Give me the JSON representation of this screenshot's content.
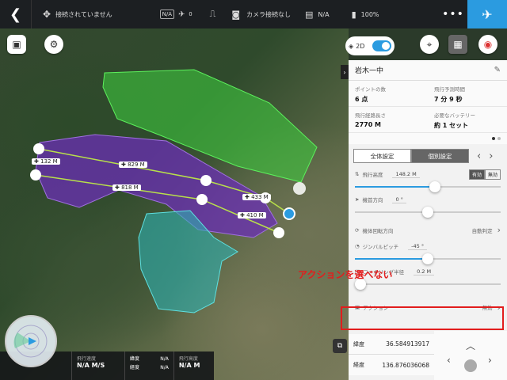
{
  "topbar": {
    "status": "接続されていません",
    "gps_badge": "N/A",
    "sat_count": "0",
    "camera": "カメラ接続なし",
    "storage": "N/A",
    "battery": "100%"
  },
  "map": {
    "toggle_label": "2D",
    "distances": [
      "132 M",
      "829 M",
      "818 M",
      "433 M",
      "410 M"
    ]
  },
  "panel": {
    "mission_name": "岩木一中",
    "stats": [
      {
        "label": "ポイントの数",
        "value": "6 点"
      },
      {
        "label": "飛行予測時間",
        "value": "7 分 9 秒"
      },
      {
        "label": "飛行経路長さ",
        "value": "2770 M"
      },
      {
        "label": "必要なバッテリー",
        "value": "約 1 セット"
      }
    ],
    "tabs": [
      "全体設定",
      "個別設定"
    ],
    "altitude": {
      "label": "飛行高度",
      "value": "148.2 M",
      "on": "有効",
      "off": "無効",
      "fraction": 0.55
    },
    "heading": {
      "label": "機首方向",
      "value": "0 °",
      "fraction": 0.5
    },
    "rotation": {
      "label": "機体回転方向",
      "value": "自動判定"
    },
    "gimbal": {
      "label": "ジンバルピッチ",
      "value": "-45 °",
      "fraction": 0.5
    },
    "radius": {
      "label": "コーナリング半径",
      "value": "0.2 M",
      "fraction": 0.02
    },
    "action": {
      "label": "アクション",
      "value": "無効"
    },
    "lat": {
      "label": "緯度",
      "value": "36.584913917"
    },
    "lng": {
      "label": "経度",
      "value": "136.876036068"
    }
  },
  "annotation": "アクションを選べない",
  "telemetry": {
    "speed_label": "飛行速度",
    "speed_val": "N/A M/S",
    "lat_label": "緯度",
    "lat_val": "N/A",
    "lng_label": "経度",
    "lng_val": "N/A",
    "alt_label": "飛行高度",
    "alt_val": "N/A M"
  }
}
